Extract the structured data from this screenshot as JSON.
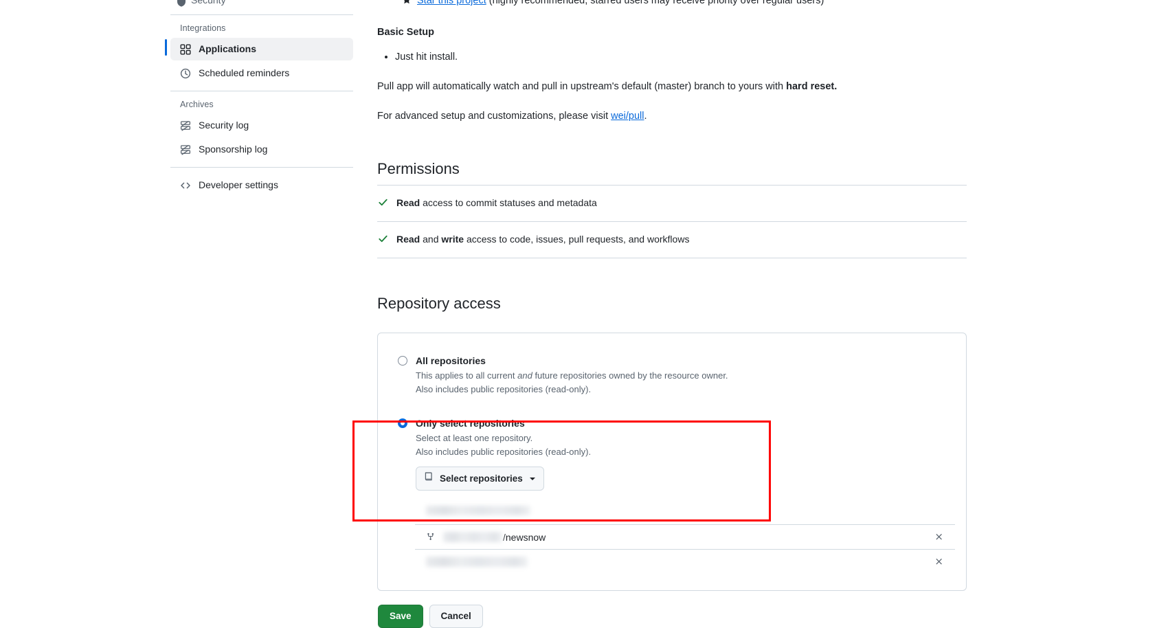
{
  "sidebar": {
    "truncated_top_item": "Security",
    "sections": [
      {
        "title": "Integrations",
        "items": [
          {
            "label": "Applications",
            "icon": "apps-icon",
            "active": true
          },
          {
            "label": "Scheduled reminders",
            "icon": "clock-icon",
            "active": false
          }
        ]
      },
      {
        "title": "Archives",
        "items": [
          {
            "label": "Security log",
            "icon": "log-icon",
            "active": false
          },
          {
            "label": "Sponsorship log",
            "icon": "log-icon",
            "active": false
          }
        ]
      }
    ],
    "developer_settings": {
      "label": "Developer settings",
      "icon": "code-icon"
    }
  },
  "main": {
    "truncated_line": {
      "link_text": "Star this project",
      "rest": " (highly recommended, starred users may receive priority over regular users)",
      "icon": "star-icon"
    },
    "basic_setup_heading": "Basic Setup",
    "basic_setup_bullets": [
      "Just hit install."
    ],
    "paragraph_1_pre": "Pull app will automatically watch and pull in upstream's default (master) branch to yours with ",
    "paragraph_1_bold": "hard reset.",
    "paragraph_2_pre": "For advanced setup and customizations, please visit ",
    "paragraph_2_link": "wei/pull",
    "paragraph_2_post": ".",
    "permissions": {
      "heading": "Permissions",
      "items": [
        {
          "bold": "Read",
          "rest": " access to commit statuses and metadata",
          "icon": "check-icon"
        },
        {
          "bold": "Read",
          "bold2": "write",
          "mid": " and ",
          "rest": " access to code, issues, pull requests, and workflows",
          "icon": "check-icon"
        }
      ]
    },
    "repository_access": {
      "heading": "Repository access",
      "options": [
        {
          "label": "All repositories",
          "desc_line1_pre": "This applies to all current ",
          "desc_line1_em": "and",
          "desc_line1_post": " future repositories owned by the resource owner.",
          "desc_line2": "Also includes public repositories (read-only).",
          "selected": false
        },
        {
          "label": "Only select repositories",
          "desc_line1": "Select at least one repository.",
          "desc_line2": "Also includes public repositories (read-only).",
          "selected": true
        }
      ],
      "select_button": {
        "label": "Select repositories",
        "icon": "repo-icon",
        "caret": "chevron-down-icon"
      },
      "repo_list": {
        "heading_redacted": true,
        "rows": [
          {
            "owner_redacted": true,
            "name": "/newsnow",
            "icon": "repo-forked-icon",
            "remove_label": "×",
            "fully_redacted": false
          },
          {
            "fully_redacted": true,
            "remove_label": "×"
          }
        ]
      }
    },
    "actions": {
      "save_label": "Save",
      "cancel_label": "Cancel"
    }
  },
  "annotation": {
    "type": "highlight-rectangle",
    "color": "#fe0000"
  },
  "colors": {
    "accent_blue": "#0969da",
    "success_green": "#1a7f37",
    "save_green": "#1f883d",
    "border": "#d1d9e0",
    "muted_text": "#59636e",
    "annotation_red": "#fe0000"
  }
}
